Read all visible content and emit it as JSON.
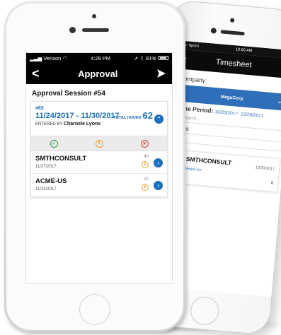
{
  "back_phone": {
    "status": {
      "carrier": "•••○ Sprint",
      "time": "10:00 AM",
      "battery": "▮"
    },
    "nav": {
      "back_glyph": "<",
      "title": "Timesheet",
      "send_glyph": "➤"
    },
    "company_label": "Company",
    "company_value": "MegaCorp",
    "period_label": "Time Period:",
    "period_value": "10/20/2017- 10/26/2017",
    "search_placeholder": "Search...",
    "lines_label": "Lines",
    "line": {
      "name": "SMTHCONSULT",
      "date": "10/20/2017",
      "company": "MegaCorp",
      "hours": "0"
    }
  },
  "front_phone": {
    "status": {
      "carrier": "Verizon",
      "time": "4:28 PM",
      "battery": "81%"
    },
    "nav": {
      "back_glyph": "<",
      "title": "Approval"
    },
    "session_title": "Approval Session #54",
    "card": {
      "id": "#63",
      "range": "11/24/2017 - 11/30/2017",
      "entered_by_label": "ENTERED BY",
      "entered_by_name": "Charnele Lyons",
      "total_label": "TOTAL HOURS",
      "total_value": "62",
      "actions": {
        "approve": "✓",
        "hold": "II",
        "reject": "✕"
      }
    },
    "lines": [
      {
        "name": "SMTHCONSULT",
        "date": "11/27/2017",
        "hours": "40",
        "badge": "II"
      },
      {
        "name": "ACME-US",
        "date": "11/24/2017",
        "hours": "22",
        "badge": "II"
      }
    ]
  },
  "colors": {
    "accent": "#1a6fc1",
    "approve": "#2e9b3f",
    "hold": "#f0a12a",
    "reject": "#d93a3a"
  }
}
